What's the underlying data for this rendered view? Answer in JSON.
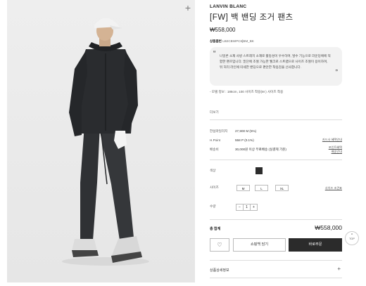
{
  "product": {
    "brand": "LANVIN BLANC",
    "title": "[FW] 백 밴딩 조거 팬츠",
    "price": "₩558,000",
    "code_label": "상품품번",
    "code_value": "LB2CBWPC6[BM_BK",
    "description": "나일론 소재 사방 스트레치 소재로 활동성이 우수하며, 발수 기능으로 라운딩에에 적합한 팬츠입니다. 밑단에 조절 가능한 웰크로 스트랩으로 사이즈 조절이 용이하며, 뒤 허리 라인에 미세한 밴딩으로 편안한 착용감을 선사합니다.",
    "model_info": "- 모델 정보 : 186cm, 100 사이즈 착용(M ) 사이즈 착용",
    "more_label": "더보기"
  },
  "benefits": {
    "points_label": "한섬마일리지",
    "points_value": "27,900 M (5%)",
    "points_link": "카드사 혜택안내",
    "hpoint_label": "H.Point",
    "hpoint_value": "558 P (0.1%)",
    "hpoint_link": "포인트혜택",
    "shipping_label": "배송비",
    "shipping_value": "30,000원 이상 무료배송 (실결제 기준)",
    "shipping_link": "배송안내"
  },
  "options": {
    "color_label": "색상",
    "color_hex": "#2c2c2c",
    "size_label": "사이즈",
    "sizes": [
      "M",
      "L",
      "XL"
    ],
    "size_guide": "사이즈 조견표",
    "qty_label": "수량",
    "qty_minus": "−",
    "qty_value": "1",
    "qty_plus": "+"
  },
  "total": {
    "label": "총 합계",
    "value": "₩558,000"
  },
  "actions": {
    "wish_icon": "♡",
    "cart": "쇼핑백 담기",
    "buy": "바로주문"
  },
  "footer": {
    "detail_label": "상품상세정보",
    "detail_plus": "+",
    "top_arrow": "^",
    "top_label": "TOP"
  },
  "gallery": {
    "zoom_icon": "+"
  }
}
